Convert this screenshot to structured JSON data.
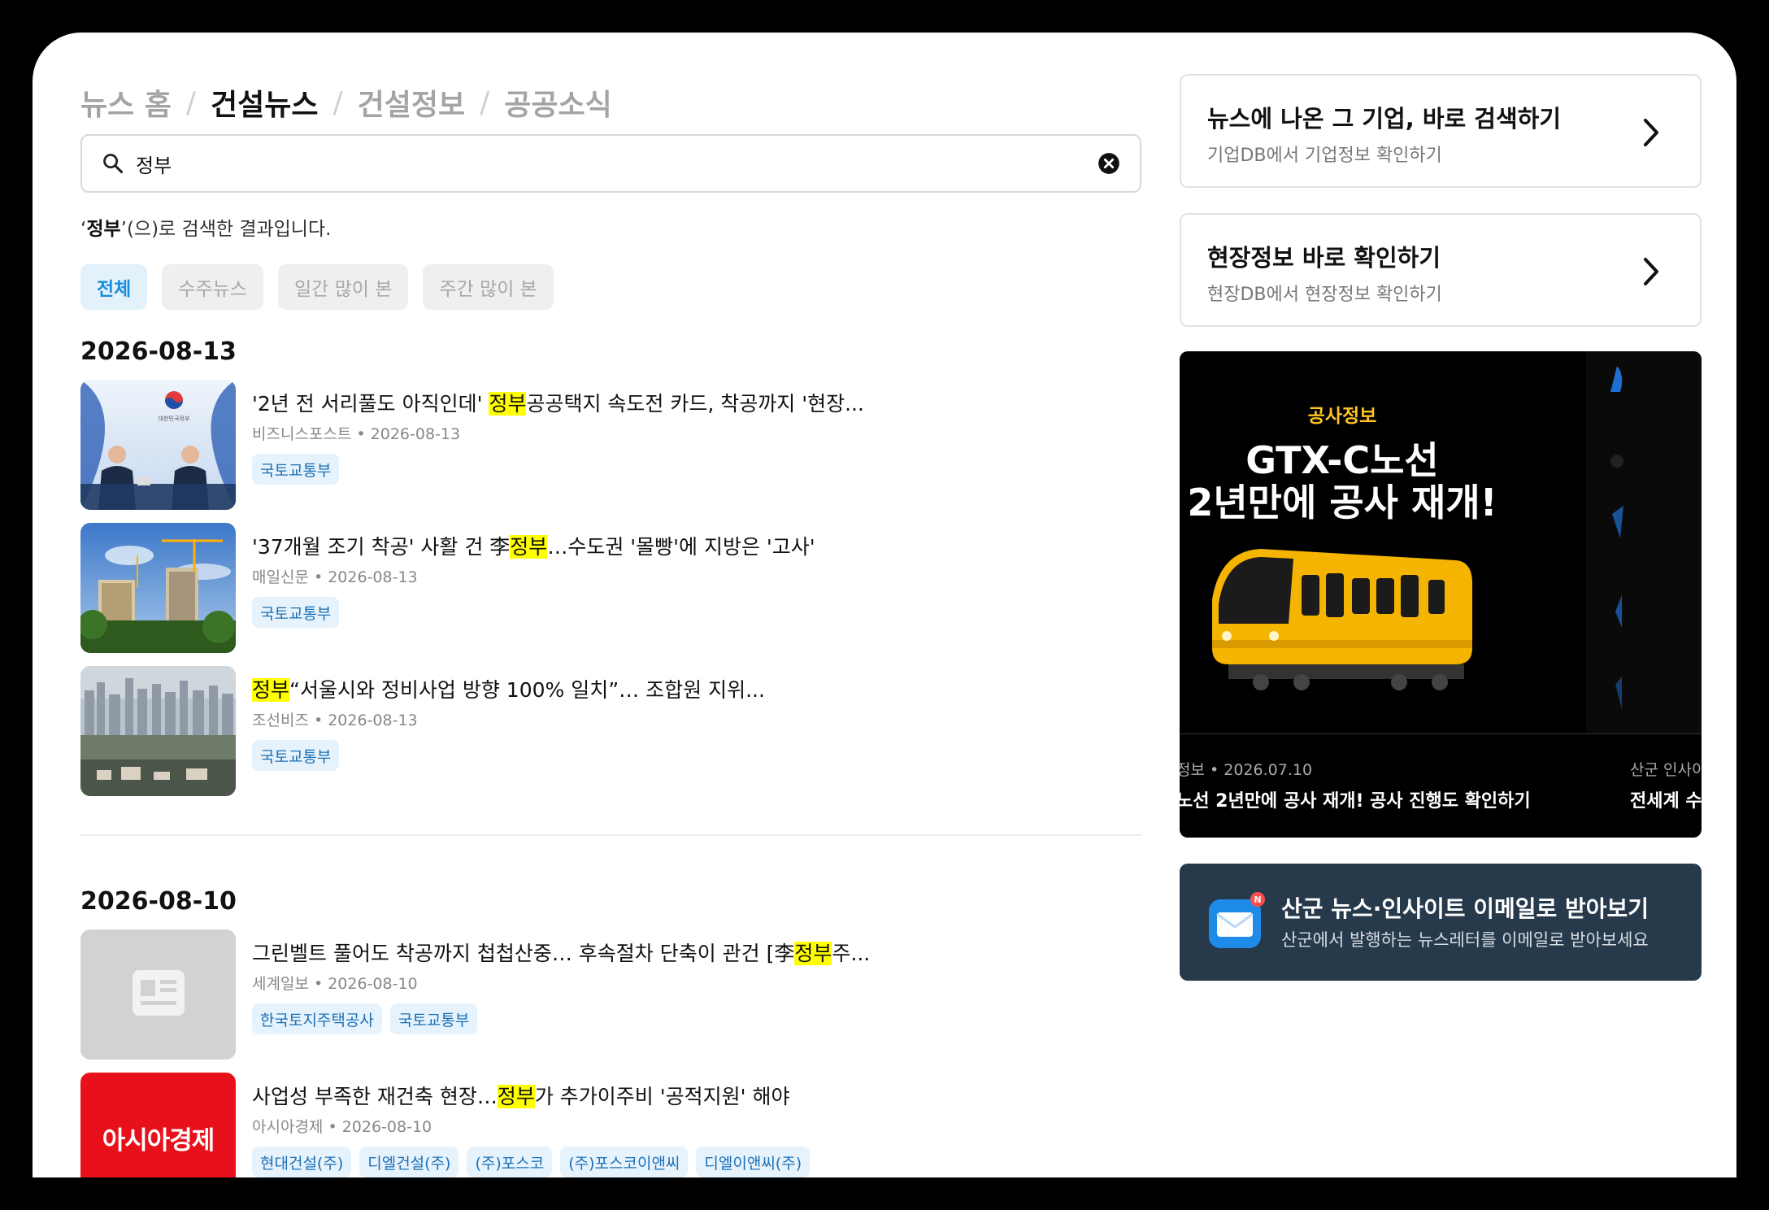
{
  "breadcrumb": {
    "items": [
      "뉴스 홈",
      "건설뉴스",
      "건설정보",
      "공공소식"
    ],
    "separator": "/"
  },
  "search": {
    "value": "정부"
  },
  "result_caption": {
    "open_quote": "‘",
    "term": "정부",
    "rest": "’(으)로 검색한 결과입니다."
  },
  "filters": [
    "전체",
    "수주뉴스",
    "일간 많이 본",
    "주간 많이 본"
  ],
  "groups": [
    {
      "date": "2026-08-13",
      "articles": [
        {
          "t1": "'2년 전 서리풀도 아직인데' ",
          "hl": "정부",
          "t2": "공공택지 속도전 카드, 착공까지 '현장...",
          "source": "비즈니스포스트",
          "date": "2026-08-13",
          "tags": [
            "국토교통부"
          ],
          "thumb_text": "대한민국정부"
        },
        {
          "t1": "'37개월 조기 착공' 사활 건 李",
          "hl": "정부",
          "t2": "…수도권 '몰빵'에 지방은 '고사'",
          "source": "매일신문",
          "date": "2026-08-13",
          "tags": [
            "국토교통부"
          ]
        },
        {
          "t1": "",
          "hl": "정부",
          "t2": "“서울시와 정비사업 방향 100% 일치”… 조합원 지위...",
          "source": "조선비즈",
          "date": "2026-08-13",
          "tags": [
            "국토교통부"
          ]
        }
      ]
    },
    {
      "date": "2026-08-10",
      "articles": [
        {
          "t1": "그린벨트 풀어도 착공까지 첩첩산중… 후속절차 단축이 관건 [李",
          "hl": "정부",
          "t2": "주...",
          "source": "세계일보",
          "date": "2026-08-10",
          "tags": [
            "한국토지주택공사",
            "국토교통부"
          ]
        },
        {
          "t1": "사업성 부족한 재건축 현장…",
          "hl": "정부",
          "t2": "가 추가이주비 '공적지원' 해야",
          "source": "아시아경제",
          "date": "2026-08-10",
          "tags": [
            "현대건설(주)",
            "디엘건설(주)",
            "(주)포스코",
            "(주)포스코이앤씨",
            "디엘이앤씨(주)"
          ],
          "thumb_text": "아시아경제"
        }
      ]
    }
  ],
  "cards": [
    {
      "title": "뉴스에 나온 그 기업, 바로 검색하기",
      "subtitle": "기업DB에서 기업정보 확인하기"
    },
    {
      "title": "현장정보 바로 확인하기",
      "subtitle": "현장DB에서 현장정보 확인하기"
    }
  ],
  "banner": {
    "label": "공사정보",
    "headline_1": "GTX-C노선",
    "headline_2": "2년만에 공사 재개!",
    "left_meta": "정보 • 2026.07.10",
    "left_title": "노선 2년만에 공사 재개! 공사 진행도 확인하기",
    "right_meta": "산군 인사이",
    "right_title": "전세계 수"
  },
  "newsletter": {
    "title": "산군 뉴스·인사이트 이메일로 받아보기",
    "subtitle": "산군에서 발행하는 뉴스레터를 이메일로 받아보세요",
    "badge": "N"
  },
  "colors": {
    "highlight": "#ffff00",
    "accent": "#1b8de0",
    "tag_bg": "#e7f3fc",
    "newsletter_bg": "#273a4c",
    "banner_label": "#ffc322"
  }
}
